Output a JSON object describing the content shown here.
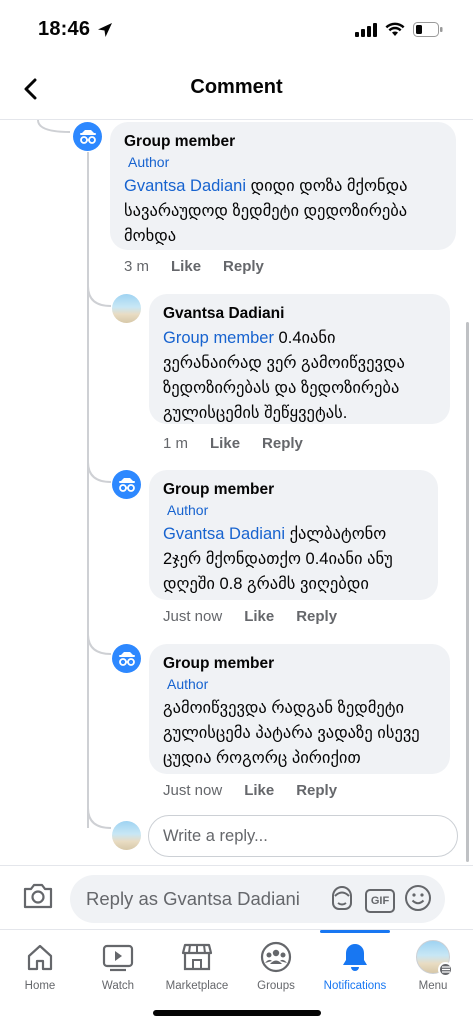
{
  "status": {
    "time": "18:46"
  },
  "header": {
    "title": "Comment"
  },
  "comments": [
    {
      "author": "Group member",
      "badge": "Author",
      "mention": "Gvantsa Dadiani",
      "text": " დიდი დოზა მქონდა სავარაუდოდ ზედმეტი დედოზირება მოხდა",
      "time": "3 m",
      "like": "Like",
      "reply": "Reply"
    },
    {
      "author": "Gvantsa Dadiani",
      "badge": "",
      "mention": "Group member",
      "text": " 0.4იანი ვერანაირად ვერ გამოიწვევდა ზედოზირებას და ზედოზირება გულისცემის შეწყვეტას.",
      "time": "1 m",
      "like": "Like",
      "reply": "Reply"
    },
    {
      "author": "Group member",
      "badge": "Author",
      "mention": "Gvantsa Dadiani",
      "text": " ქალბატონო 2ჯერ მქონდათქო 0.4იანი ანუ დღეში 0.8 გრამს ვიღებდი",
      "time": "Just now",
      "like": "Like",
      "reply": "Reply"
    },
    {
      "author": "Group member",
      "badge": "Author",
      "mention": "",
      "text": "გამოიწვევდა რადგან ზედმეტი გულისცემა პატარა ვადაზე ისევე ცუდია როგორც პირიქით",
      "time": "Just now",
      "like": "Like",
      "reply": "Reply"
    }
  ],
  "reply_box": {
    "placeholder": "Write a reply..."
  },
  "composer": {
    "placeholder": "Reply as Gvantsa Dadiani",
    "gif_label": "GIF"
  },
  "tabs": [
    {
      "label": "Home",
      "icon": "home-icon"
    },
    {
      "label": "Watch",
      "icon": "watch-icon"
    },
    {
      "label": "Marketplace",
      "icon": "marketplace-icon"
    },
    {
      "label": "Groups",
      "icon": "groups-icon"
    },
    {
      "label": "Notifications",
      "icon": "bell-icon",
      "active": true
    },
    {
      "label": "Menu",
      "icon": "profile-avatar"
    }
  ],
  "colors": {
    "accent": "#1877f2",
    "link": "#1763cf",
    "bubble": "#f0f2f5",
    "muted": "#65676b"
  }
}
